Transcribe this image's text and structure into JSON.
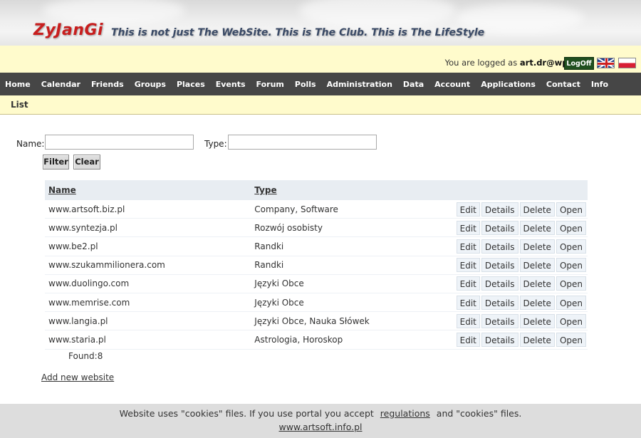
{
  "header": {
    "logo": "ZyJanGi",
    "slogan": "This is not just The WebSite. This is The Club. This is The LifeStyle"
  },
  "userbar": {
    "logged_prefix": "You are logged as ",
    "user": "art.dr@wp.pl",
    "logoff_label": "LogOff",
    "flags": [
      "english-flag-icon",
      "polish-flag-icon"
    ]
  },
  "nav": {
    "items": [
      "Home",
      "Calendar",
      "Friends",
      "Groups",
      "Places",
      "Events",
      "Forum",
      "Polls",
      "Administration",
      "Data",
      "Account",
      "Applications",
      "Contact",
      "Info"
    ]
  },
  "subbar": {
    "title": "List"
  },
  "filter": {
    "name_label": "Name:",
    "name_value": "",
    "type_label": "Type:",
    "type_value": "",
    "filter_button": "Filter",
    "clear_button": "Clear"
  },
  "table": {
    "columns": [
      "Name",
      "Type"
    ],
    "actions": [
      "Edit",
      "Details",
      "Delete",
      "Open"
    ],
    "rows": [
      {
        "name": "www.artsoft.biz.pl",
        "type": "Company, Software"
      },
      {
        "name": "www.syntezja.pl",
        "type": "Rozwój osobisty"
      },
      {
        "name": "www.be2.pl",
        "type": "Randki"
      },
      {
        "name": "www.szukammilionera.com",
        "type": "Randki"
      },
      {
        "name": "www.duolingo.com",
        "type": "Języki Obce"
      },
      {
        "name": "www.memrise.com",
        "type": "Języki Obce"
      },
      {
        "name": "www.langia.pl",
        "type": "Języki Obce, Nauka Słówek"
      },
      {
        "name": "www.staria.pl",
        "type": "Astrologia, Horoskop"
      }
    ],
    "found": "Found:8",
    "add_new": "Add new website"
  },
  "footer": {
    "cookies_prefix": "Website uses \"cookies\" files. If you use portal you accept",
    "regulations": "regulations",
    "cookies_suffix": "and \"cookies\" files.",
    "site": "www.artsoft.info.pl"
  },
  "colors": {
    "logo": "#c81e1e",
    "slogan": "#3a4a66",
    "nav_bg": "#464646",
    "userbar_bg": "#fffbcc",
    "logoff_bg": "#1f4f1f",
    "table_header_bg": "#e8edf2",
    "footer_bg": "#dddddd"
  }
}
